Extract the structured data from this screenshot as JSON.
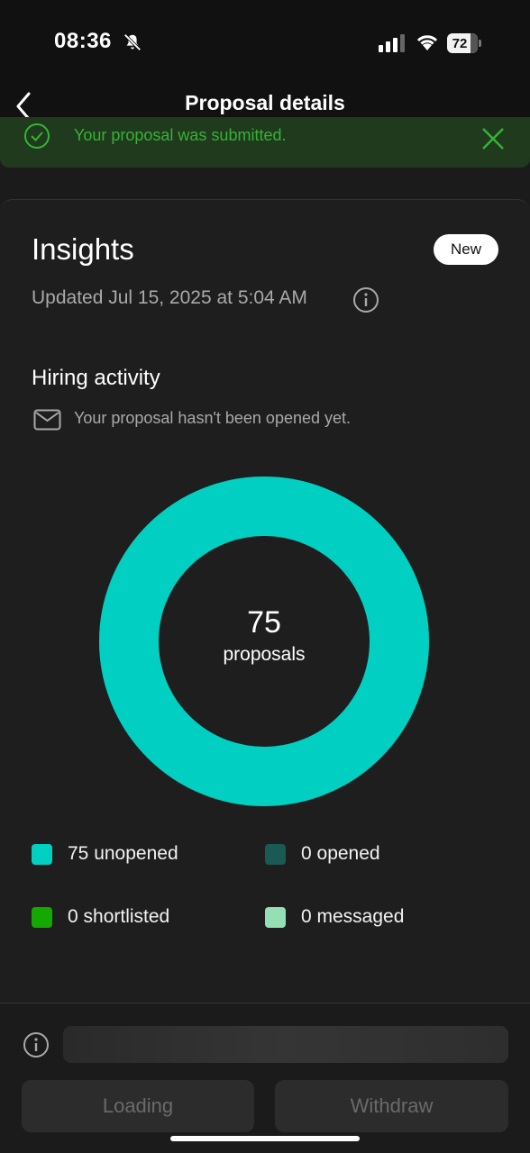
{
  "status_bar": {
    "time": "08:36",
    "battery": "72"
  },
  "nav": {
    "title": "Proposal details"
  },
  "toast": {
    "message": "Your proposal was submitted."
  },
  "insights": {
    "title": "Insights",
    "badge": "New",
    "updated": "Updated Jul 15, 2025 at 5:04 AM"
  },
  "hiring": {
    "title": "Hiring activity",
    "status": "Your proposal hasn't been opened yet."
  },
  "donut": {
    "count": "75",
    "label": "proposals",
    "unopened_fraction": 1.0
  },
  "legend": [
    {
      "label": "75 unopened",
      "color": "#00cfc1"
    },
    {
      "label": "0 opened",
      "color": "#1b5955"
    },
    {
      "label": "0 shortlisted",
      "color": "#14a800"
    },
    {
      "label": "0 messaged",
      "color": "#95dfb5"
    }
  ],
  "colors": {
    "accent": "#00cfc1",
    "success": "#37b237",
    "background": "#1b1b1b"
  },
  "buttons": {
    "loading": "Loading",
    "withdraw": "Withdraw"
  }
}
